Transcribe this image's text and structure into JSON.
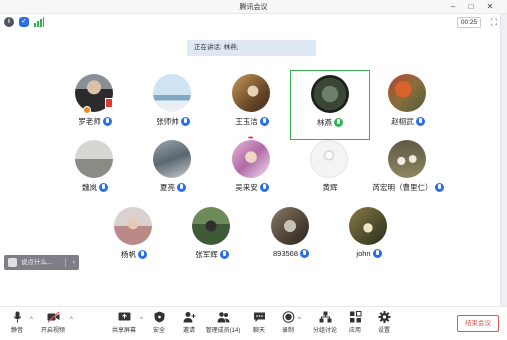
{
  "window": {
    "title": "腾讯会议",
    "controls": {
      "minimize": "–",
      "maximize": "□",
      "close": "✕"
    }
  },
  "info_bar": {
    "timer": "00:25",
    "icons": [
      "info-icon",
      "shield-icon",
      "signal-icon",
      "fullscreen-icon"
    ]
  },
  "speaking_banner": {
    "text": "正在讲话: 林燕;"
  },
  "participants": [
    {
      "name": "罗老师",
      "mic": "blue"
    },
    {
      "name": "张师帅",
      "mic": "blue"
    },
    {
      "name": "王玉洁",
      "mic": "blue"
    },
    {
      "name": "林燕",
      "mic": "green",
      "active": true
    },
    {
      "name": "赵栩武",
      "mic": "blue"
    },
    {
      "name": "魏岚",
      "mic": "blue"
    },
    {
      "name": "夏亮",
      "mic": "blue"
    },
    {
      "name": "吴来安",
      "mic": "blue"
    },
    {
      "name": "黄辉",
      "mic": "none"
    },
    {
      "name": "芮宏明（曹里仁）",
      "mic": "blue"
    },
    {
      "name": "杨帆",
      "mic": "blue"
    },
    {
      "name": "张军辉",
      "mic": "blue"
    },
    {
      "name": "893568",
      "mic": "blue"
    },
    {
      "name": "john",
      "mic": "blue"
    }
  ],
  "chat_pill": {
    "text": "说点什么...",
    "arrow": "‹"
  },
  "toolbar": {
    "mute": "静音",
    "video": "开启视频",
    "share": "共享屏幕",
    "security": "安全",
    "invite": "邀请",
    "manage": "管理成员(14)",
    "chat": "聊天",
    "record": "录制",
    "breakout": "分组讨论",
    "apps": "应用",
    "settings": "设置",
    "end": "结束会议"
  },
  "colors": {
    "accent": "#2b6fe6",
    "active_border": "#37b24d",
    "end_button": "#e2534b",
    "banner": "#dfe9f6"
  }
}
